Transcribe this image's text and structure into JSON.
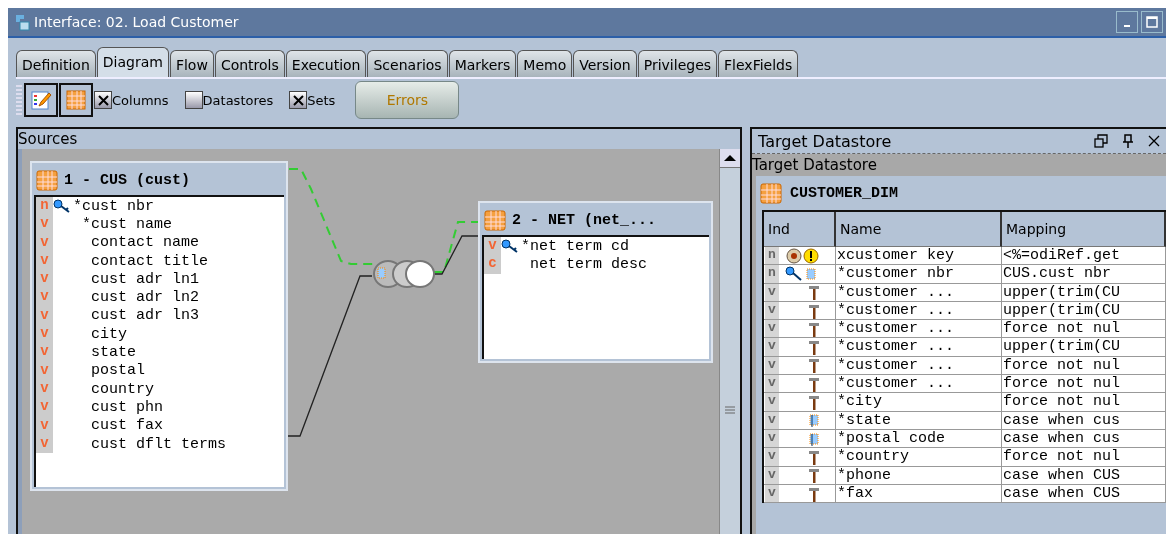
{
  "window": {
    "title": "Interface: 02. Load Customer"
  },
  "tabs": [
    {
      "label": "Definition",
      "selected": false
    },
    {
      "label": "Diagram",
      "selected": true
    },
    {
      "label": "Flow",
      "selected": false
    },
    {
      "label": "Controls",
      "selected": false
    },
    {
      "label": "Execution",
      "selected": false
    },
    {
      "label": "Scenarios",
      "selected": false
    },
    {
      "label": "Markers",
      "selected": false
    },
    {
      "label": "Memo",
      "selected": false
    },
    {
      "label": "Version",
      "selected": false
    },
    {
      "label": "Privileges",
      "selected": false
    },
    {
      "label": "FlexFields",
      "selected": false
    }
  ],
  "toolbar": {
    "checkboxes": [
      {
        "label": "Columns",
        "checked": true
      },
      {
        "label": "Datastores",
        "checked": false
      },
      {
        "label": "Sets",
        "checked": true
      }
    ],
    "errors_button": {
      "label": "Errors"
    }
  },
  "sources": {
    "title": "Sources",
    "datastores": [
      {
        "title": "1 - CUS (cust)",
        "columns": [
          {
            "ind": "n",
            "key": true,
            "name": "*cust nbr"
          },
          {
            "ind": "v",
            "key": false,
            "name": " *cust name"
          },
          {
            "ind": "v",
            "key": false,
            "name": "  contact name"
          },
          {
            "ind": "v",
            "key": false,
            "name": "  contact title"
          },
          {
            "ind": "v",
            "key": false,
            "name": "  cust adr ln1"
          },
          {
            "ind": "v",
            "key": false,
            "name": "  cust adr ln2"
          },
          {
            "ind": "v",
            "key": false,
            "name": "  cust adr ln3"
          },
          {
            "ind": "v",
            "key": false,
            "name": "  city"
          },
          {
            "ind": "v",
            "key": false,
            "name": "  state"
          },
          {
            "ind": "v",
            "key": false,
            "name": "  postal"
          },
          {
            "ind": "v",
            "key": false,
            "name": "  country"
          },
          {
            "ind": "v",
            "key": false,
            "name": "  cust phn"
          },
          {
            "ind": "v",
            "key": false,
            "name": "  cust fax"
          },
          {
            "ind": "v",
            "key": false,
            "name": "  cust dflt terms"
          }
        ]
      },
      {
        "title": "2 - NET (net_...",
        "columns": [
          {
            "ind": "v",
            "key": true,
            "name": "*net term cd"
          },
          {
            "ind": "c",
            "key": false,
            "name": " net term desc"
          }
        ]
      }
    ]
  },
  "target": {
    "panel_title": "Target Datastore",
    "section_label": "Target Datastore",
    "datastore": "CUSTOMER_DIM",
    "columns": [
      "Ind",
      "Name",
      "Mapping"
    ],
    "rows": [
      {
        "ind": "n",
        "kind": "target",
        "name": "xcustomer key",
        "mapping": "<%=odiRef.get"
      },
      {
        "ind": "n",
        "kind": "key",
        "name": "*customer nbr",
        "mapping": "CUS.cust nbr"
      },
      {
        "ind": "v",
        "kind": "hammer",
        "name": "*customer ...",
        "mapping": "upper(trim(CU"
      },
      {
        "ind": "v",
        "kind": "hammer",
        "name": "*customer ...",
        "mapping": "upper(trim(CU"
      },
      {
        "ind": "v",
        "kind": "hammer",
        "name": "*customer ...",
        "mapping": "force not nul"
      },
      {
        "ind": "v",
        "kind": "hammer",
        "name": "*customer ...",
        "mapping": "upper(trim(CU"
      },
      {
        "ind": "v",
        "kind": "hammer",
        "name": "*customer ...",
        "mapping": "force not nul"
      },
      {
        "ind": "v",
        "kind": "hammer",
        "name": "*customer ...",
        "mapping": "force not nul"
      },
      {
        "ind": "v",
        "kind": "hammer",
        "name": "*city",
        "mapping": "force not nul"
      },
      {
        "ind": "v",
        "kind": "flag",
        "name": "*state",
        "mapping": "case when cus"
      },
      {
        "ind": "v",
        "kind": "flag",
        "name": "*postal code",
        "mapping": "case when cus"
      },
      {
        "ind": "v",
        "kind": "hammer",
        "name": "*country",
        "mapping": "force not nul"
      },
      {
        "ind": "v",
        "kind": "hammer",
        "name": "*phone",
        "mapping": "case when CUS"
      },
      {
        "ind": "v",
        "kind": "hammer",
        "name": "*fax",
        "mapping": "case when CUS"
      }
    ]
  }
}
